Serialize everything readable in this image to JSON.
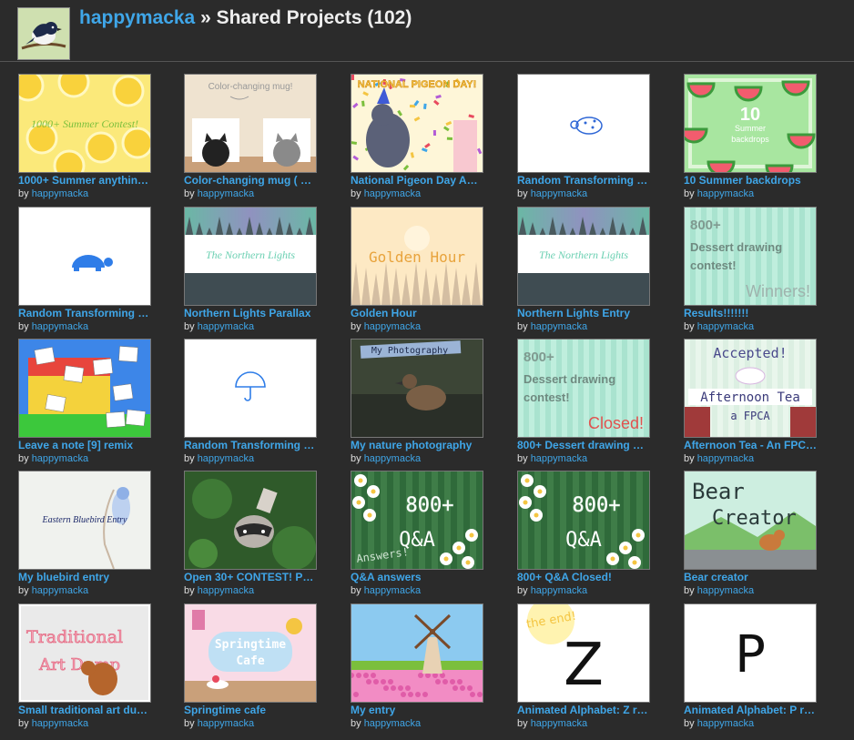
{
  "header": {
    "username": "happymacka",
    "separator": " » ",
    "title": "Shared Projects (102)"
  },
  "by_prefix": "by ",
  "projects": [
    {
      "title": "1000+ Summer anythin…",
      "author": "happymacka",
      "thumb_text": "1000+ Summer Contest!",
      "thumb_icon": "lemons"
    },
    {
      "title": "Color-changing mug ( …",
      "author": "happymacka",
      "thumb_text": "Color-changing mug!",
      "thumb_icon": "mugs-with-cats"
    },
    {
      "title": "National Pigeon Day Ani…",
      "author": "happymacka",
      "thumb_text": "NATIONAL PIGEON DAY!",
      "thumb_icon": "pigeon"
    },
    {
      "title": "Random Transforming (…",
      "author": "happymacka",
      "thumb_text": "",
      "thumb_icon": "ladybug"
    },
    {
      "title": "10 Summer backdrops",
      "author": "happymacka",
      "thumb_text": "10 Summer backdrops",
      "thumb_icon": "watermelons"
    },
    {
      "title": "Random Transforming (…",
      "author": "happymacka",
      "thumb_text": "",
      "thumb_icon": "turtle"
    },
    {
      "title": "Northern Lights Parallax",
      "author": "happymacka",
      "thumb_text": "The Northern Lights",
      "thumb_icon": "aurora-forest"
    },
    {
      "title": "Golden Hour",
      "author": "happymacka",
      "thumb_text": "Golden Hour",
      "thumb_icon": "golden-forest"
    },
    {
      "title": "Northern Lights Entry",
      "author": "happymacka",
      "thumb_text": "The Northern Lights",
      "thumb_icon": "aurora-forest"
    },
    {
      "title": "Results!!!!!!!",
      "author": "happymacka",
      "thumb_text": "800+ Dessert drawing contest! Winners!",
      "thumb_icon": "mint-stripes"
    },
    {
      "title": "Leave a note [9] remix",
      "author": "happymacka",
      "thumb_text": "",
      "thumb_icon": "lego-notes"
    },
    {
      "title": "Random Transforming (…",
      "author": "happymacka",
      "thumb_text": "",
      "thumb_icon": "umbrella"
    },
    {
      "title": "My nature photography",
      "author": "happymacka",
      "thumb_text": "My Photography",
      "thumb_icon": "duck-photo"
    },
    {
      "title": "800+ Dessert drawing …",
      "author": "happymacka",
      "thumb_text": "800+ Dessert drawing contest! Closed!",
      "thumb_icon": "mint-stripes"
    },
    {
      "title": "Afternoon Tea - An FPC…",
      "author": "happymacka",
      "thumb_text": "Accepted! Afternoon Tea a FPCA",
      "thumb_icon": "teacup"
    },
    {
      "title": "My bluebird entry",
      "author": "happymacka",
      "thumb_text": "Eastern Bluebird Entry",
      "thumb_icon": "bluebird"
    },
    {
      "title": "Open 30+ CONTEST! PG…",
      "author": "happymacka",
      "thumb_text": "",
      "thumb_icon": "raccoon"
    },
    {
      "title": "Q&A answers",
      "author": "happymacka",
      "thumb_text": "800+ Q&A Answers!",
      "thumb_icon": "daisies"
    },
    {
      "title": "800+ Q&A Closed!",
      "author": "happymacka",
      "thumb_text": "800+ Q&A",
      "thumb_icon": "daisies"
    },
    {
      "title": "Bear creator",
      "author": "happymacka",
      "thumb_text": "Bear Creator",
      "thumb_icon": "bear"
    },
    {
      "title": "Small traditional art du…",
      "author": "happymacka",
      "thumb_text": "Traditional Art Dump",
      "thumb_icon": "squirrel"
    },
    {
      "title": "Springtime cafe",
      "author": "happymacka",
      "thumb_text": "Springtime Cafe",
      "thumb_icon": "cafe"
    },
    {
      "title": "My entry",
      "author": "happymacka",
      "thumb_text": "",
      "thumb_icon": "windmill"
    },
    {
      "title": "Animated Alphabet: Z r…",
      "author": "happymacka",
      "thumb_text": "the end! Z",
      "thumb_icon": "letter-z"
    },
    {
      "title": "Animated Alphabet: P r…",
      "author": "happymacka",
      "thumb_text": "P",
      "thumb_icon": "letter-p"
    }
  ]
}
